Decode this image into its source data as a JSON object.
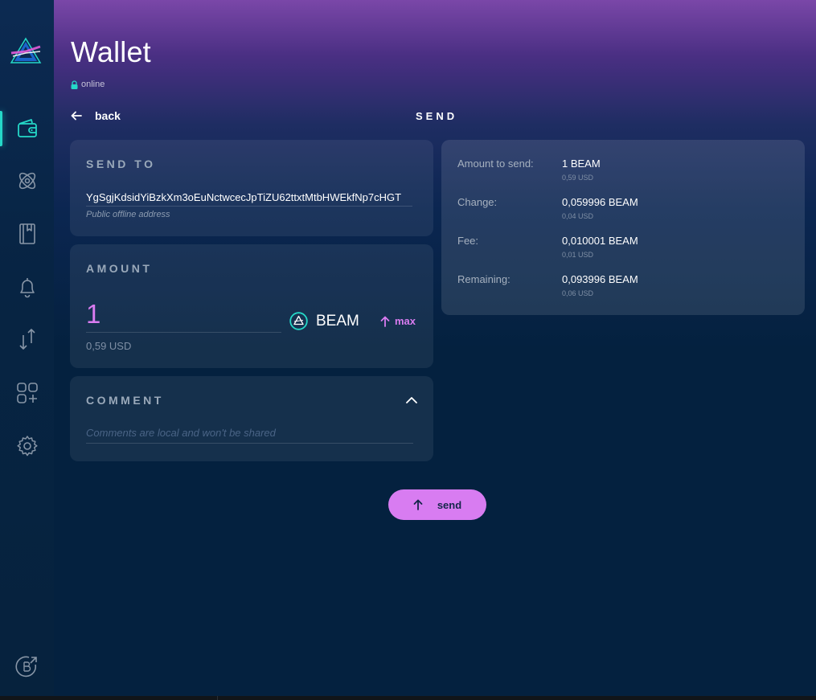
{
  "sidebar": {
    "items": [
      {
        "id": "wallet",
        "icon": "wallet-icon",
        "active": true
      },
      {
        "id": "atomic-swap",
        "icon": "atom-icon",
        "active": false
      },
      {
        "id": "address-book",
        "icon": "address-book-icon",
        "active": false
      },
      {
        "id": "notifications",
        "icon": "bell-icon",
        "active": false
      },
      {
        "id": "utxo",
        "icon": "transfer-arrows-icon",
        "active": false
      },
      {
        "id": "applications",
        "icon": "apps-plus-icon",
        "active": false
      },
      {
        "id": "settings",
        "icon": "gear-icon",
        "active": false
      }
    ],
    "bottom_icon": "beam-explorer-link-icon"
  },
  "header": {
    "title": "Wallet",
    "status": "online",
    "back_label": "back",
    "subtitle": "SEND"
  },
  "send_to": {
    "title": "SEND TO",
    "address": "YgSgjKdsidYiBzkXm3oEuNctwcecJpTiZU62ttxtMtbHWEkfNp7cHGT",
    "address_hint": "Public offline address"
  },
  "amount": {
    "title": "AMOUNT",
    "value": "1",
    "usd": "0,59 USD",
    "asset": "BEAM",
    "max_label": "max"
  },
  "comment": {
    "title": "COMMENT",
    "placeholder": "Comments are local and won't be shared"
  },
  "summary": {
    "rows": [
      {
        "label": "Amount to send:",
        "value": "1  BEAM",
        "usd": "0,59 USD"
      },
      {
        "label": "Change:",
        "value": "0,059996  BEAM",
        "usd": "0,04 USD"
      },
      {
        "label": "Fee:",
        "value": "0,010001  BEAM",
        "usd": "0,01 USD"
      },
      {
        "label": "Remaining:",
        "value": "0,093996  BEAM",
        "usd": "0,06 USD"
      }
    ]
  },
  "send_button": {
    "label": "send"
  },
  "colors": {
    "accent": "#25d8c8",
    "primary_button": "#d87cf1",
    "background": "#04213f"
  }
}
